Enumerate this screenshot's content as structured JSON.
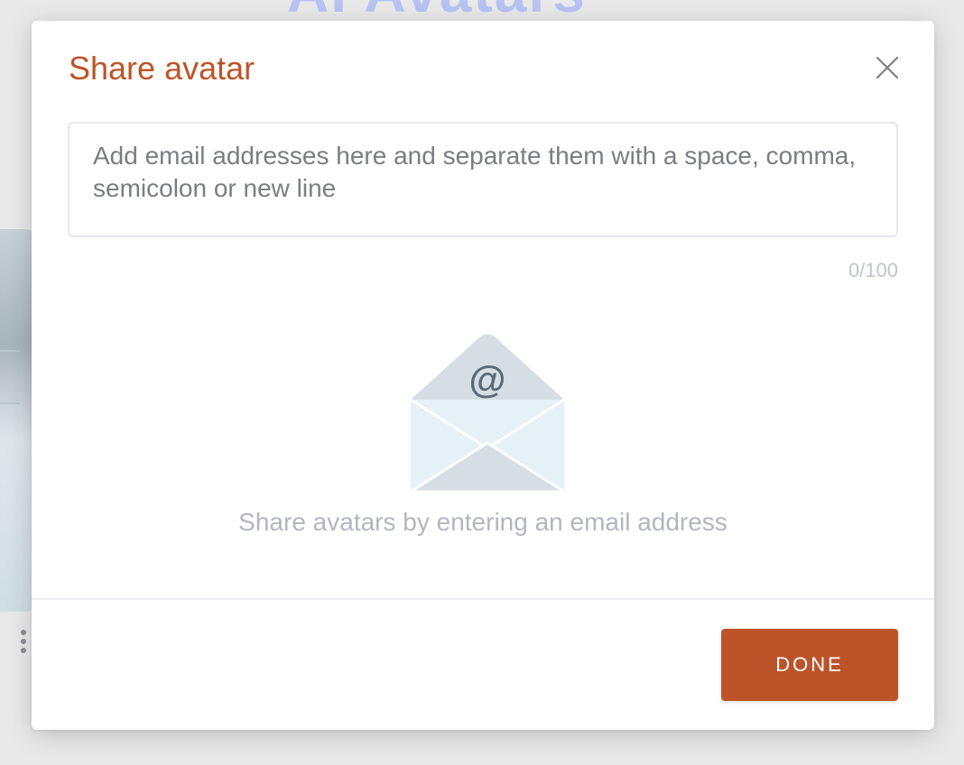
{
  "background": {
    "title_fragment": "AI Avatars"
  },
  "modal": {
    "title": "Share avatar",
    "email_input": {
      "value": "",
      "placeholder": "Add email addresses here and separate them with a space, comma, semicolon or new line"
    },
    "counter": "0/100",
    "empty_state": {
      "icon": "envelope-at-icon",
      "at_symbol": "@",
      "message": "Share avatars by entering an email address"
    },
    "done_label": "DONE",
    "close_icon": "close-icon"
  },
  "colors": {
    "accent": "#bd5429",
    "envelope_back": "#d5dee5",
    "envelope_front": "#e6f0f7",
    "at_symbol": "#5c6a78",
    "placeholder": "#7b7d83",
    "muted": "#b3b6c0"
  }
}
